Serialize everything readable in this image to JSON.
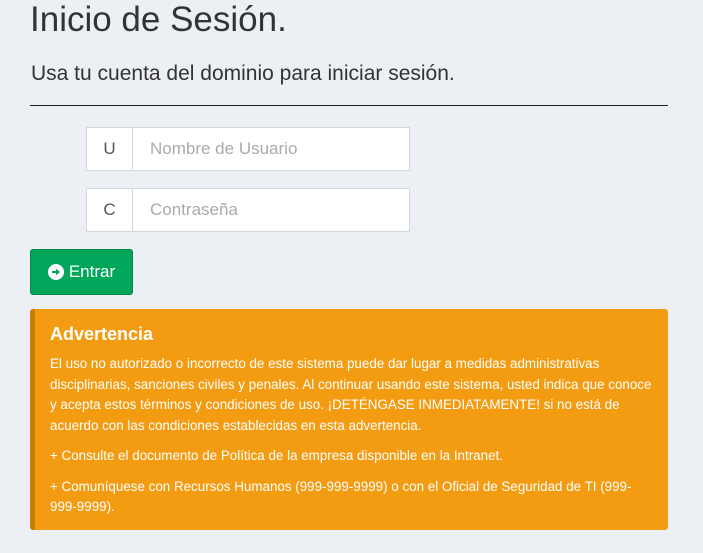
{
  "header": {
    "title": "Inicio de Sesión.",
    "subtitle": "Usa tu cuenta del dominio para iniciar sesión."
  },
  "form": {
    "username": {
      "addon": "U",
      "placeholder": "Nombre de Usuario",
      "value": ""
    },
    "password": {
      "addon": "C",
      "placeholder": "Contraseña",
      "value": ""
    },
    "submit": {
      "label": "Entrar",
      "icon": "arrow-circle-right-icon"
    }
  },
  "warning": {
    "title": "Advertencia",
    "body": "El uso no autorizado o incorrecto de este sistema puede dar lugar a medidas administrativas disciplinarias, sanciones civiles y penales. Al continuar usando este sistema, usted indica que conoce y acepta estos términos y condiciones de uso. ¡DETÉNGASE INMEDIATAMENTE! si no está de acuerdo con las condiciones establecidas en esta advertencia.",
    "note_policy": "+ Consulte el documento de Política de la empresa disponible en la Intranet.",
    "note_contact": "+ Comuníquese con Recursos Humanos (999-999-9999) o con el Oficial de Seguridad de TI (999-999-9999)."
  },
  "colors": {
    "background": "#ecf0f5",
    "button": "#00a65a",
    "warning": "#f39c12",
    "warning_border": "#c87f0a"
  }
}
